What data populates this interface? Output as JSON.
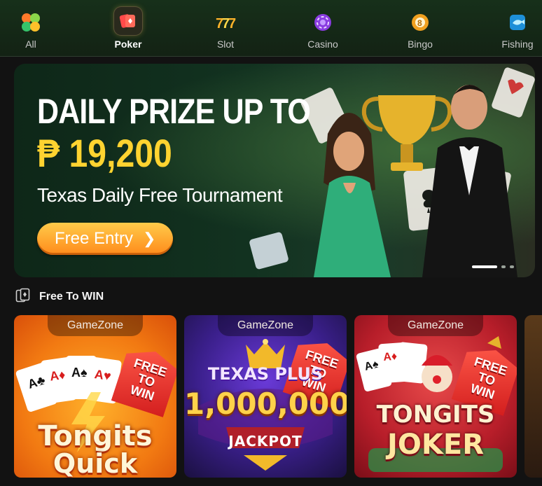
{
  "nav": {
    "items": [
      {
        "label": "All",
        "icon": "clover-icon"
      },
      {
        "label": "Poker",
        "icon": "poker-cards-icon",
        "active": true
      },
      {
        "label": "Slot",
        "icon": "slot-777-icon"
      },
      {
        "label": "Casino",
        "icon": "casino-chip-icon"
      },
      {
        "label": "Bingo",
        "icon": "bingo-ball-icon"
      },
      {
        "label": "Fishing",
        "icon": "fish-icon"
      }
    ]
  },
  "banner": {
    "headline": "DAILY PRIZE UP TO",
    "amount": "₱ 19,200",
    "subtitle": "Texas Daily Free Tournament",
    "cta_label": "Free Entry",
    "slides_total": 3,
    "slide_active": 1
  },
  "section": {
    "title": "Free To WIN"
  },
  "cards": [
    {
      "zone": "GameZone",
      "tag_line1": "FREE",
      "tag_line2": "TO",
      "tag_line3": "WIN",
      "title_line1": "Tongits",
      "title_line2": "Quick"
    },
    {
      "zone": "GameZone",
      "tag_line1": "FREE",
      "tag_line2": "TO",
      "tag_line3": "WIN",
      "title_line1": "TEXAS PLUS",
      "title_line2": "1,000,000",
      "title_line3": "JACKPOT"
    },
    {
      "zone": "GameZone",
      "tag_line1": "FREE",
      "tag_line2": "TO",
      "tag_line3": "WIN",
      "title_line1": "TONGITS",
      "title_line2": "JOKER"
    }
  ],
  "colors": {
    "accent_gold": "#ffd330",
    "cta_orange": "#ff8a1a",
    "bg": "#121212"
  }
}
